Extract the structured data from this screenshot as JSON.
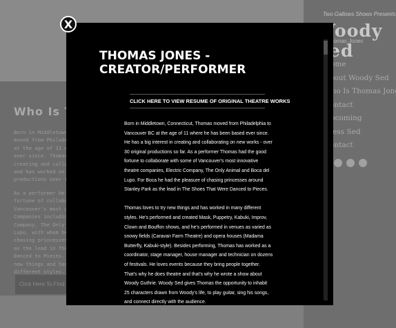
{
  "background": {
    "section_title": "Who Is Thomas Jones",
    "text_1": "Born in Middletown,\nmoved from Philadelphia\nat the age of 11 where\never since. Thomas h\ncreating and collabor\nand has worked on ov\nproductions over the",
    "text_2": "As a performer he ha\nfortune of collabora\nVancouver's most ori\nCompanies including\nCompany, The Only An\nLupo, with whom he h\nchasing princesses a\nas the lead in The S\nDanced to Pieces. Th\nnew things and has w\ndifferent styles.",
    "link_label": "Click Here To Find More",
    "brand_subtitle": "Two Gallows Shows Presents",
    "brand_title": "Woody Sed",
    "brand_tagline": "Thomas Jones",
    "nav": [
      "Home",
      "About Woody Sed",
      "Who Is Thomas Jones",
      "Contact",
      "Upcoming",
      "Press Sed",
      "Contact"
    ],
    "colors": {
      "overlay": "#7d7d7d"
    }
  },
  "modal": {
    "close_label": "X",
    "title": "THOMAS JONES - CREATOR/PERFORMER",
    "resume_link": "CLICK HERE TO VIEW RESUME OF ORIGINAL THEATRE WORKS",
    "paragraphs": [
      "Born in Middletown, Connecticut, Thomas moved from Philadelphia to Vancouver BC at the age of 11 where he has been based ever since. He has a big interest in creating and collaborating on new works - over 30 original productions so far. As a performer Thomas had the good fortune to collaborate with some of Vancouver's most innovative theatre companies, Electric Company, The Only Animal and Boca del Lupo. For Boca he had the pleasure of chasing princesses around Stanley Park as the lead in The Shoes That Were Danced to Pieces.",
      "Thomas loves to try new things and has worked in many different styles. He's performed and created Mask, Puppetry, Kabuki, Improv, Clown and Bouffon shows, and he's performed in venues as varied as snowy fields (Caravan Farm Theatre) and opera houses (Madama Butterfly, Kabuki-style). Besides performing, Thomas has worked as a coordinator, stage manager, house manager and technician on dozens of festivals. He loves events because they bring people together. That's why he does theatre and that's why he wrote a show about Woody Guthrie. Woody Sed gives Thomas the opportunity to inhabit 25 characters drawn from Woody's life, to play guitar, sing his songs, and connect directly with the audience."
    ],
    "colors": {
      "background": "#000000",
      "text": "#ffffff"
    }
  }
}
